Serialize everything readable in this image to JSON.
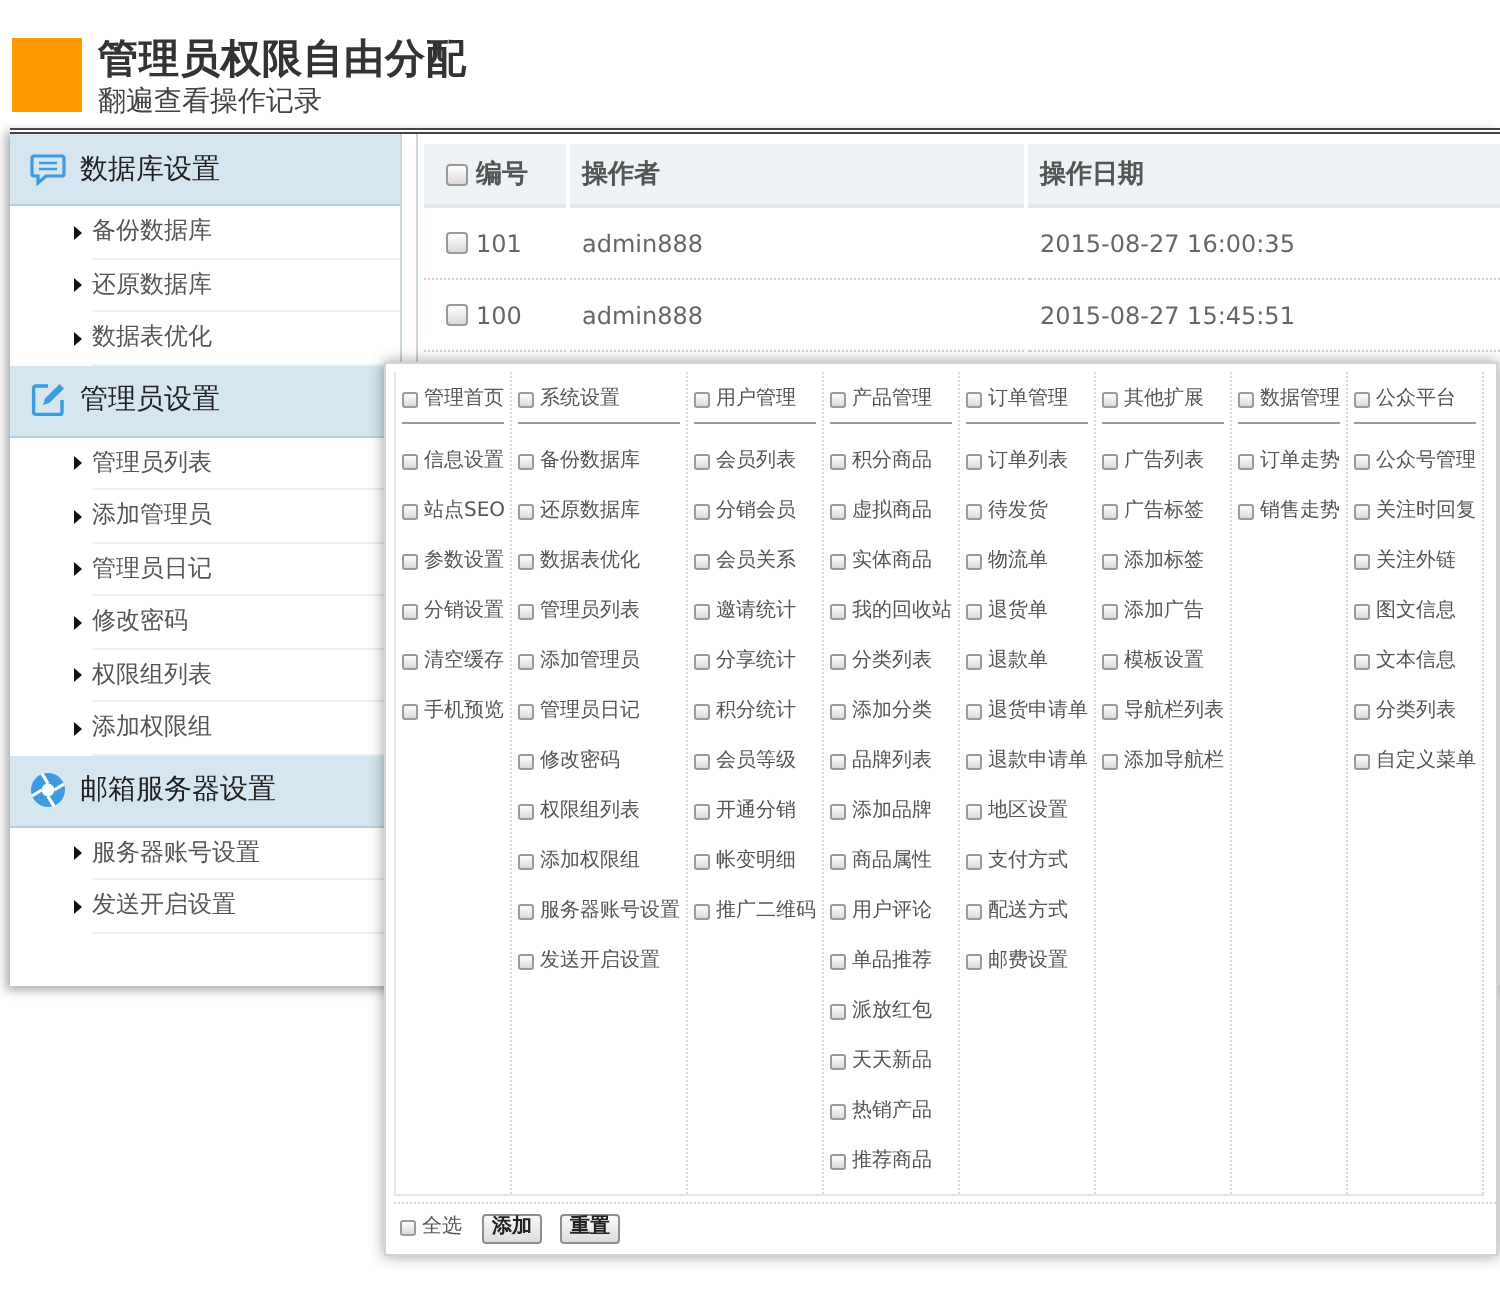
{
  "header": {
    "title": "管理员权限自由分配",
    "subtitle": "翻遍查看操作记录"
  },
  "sidebar": {
    "sections": [
      {
        "title": "数据库设置",
        "items": [
          "备份数据库",
          "还原数据库",
          "数据表优化"
        ]
      },
      {
        "title": "管理员设置",
        "items": [
          "管理员列表",
          "添加管理员",
          "管理员日记",
          "修改密码",
          "权限组列表",
          "添加权限组"
        ]
      },
      {
        "title": "邮箱服务器设置",
        "items": [
          "服务器账号设置",
          "发送开启设置"
        ]
      }
    ]
  },
  "log_table": {
    "select_all": {
      "checked": false
    },
    "columns": [
      "编号",
      "操作者",
      "操作日期"
    ],
    "rows": [
      {
        "checked": false,
        "cells": [
          "101",
          "admin888",
          "2015-08-27 16:00:35"
        ]
      },
      {
        "checked": false,
        "cells": [
          "100",
          "admin888",
          "2015-08-27 15:45:51"
        ]
      }
    ]
  },
  "permission_dialog": {
    "groups": [
      {
        "title": "管理首页",
        "checked": false,
        "items": [
          {
            "label": "信息设置",
            "checked": false
          },
          {
            "label": "站点SEO",
            "checked": false
          },
          {
            "label": "参数设置",
            "checked": false
          },
          {
            "label": "分销设置",
            "checked": false
          },
          {
            "label": "清空缓存",
            "checked": false
          },
          {
            "label": "手机预览",
            "checked": false
          }
        ]
      },
      {
        "title": "系统设置",
        "checked": false,
        "items": [
          {
            "label": "备份数据库",
            "checked": false
          },
          {
            "label": "还原数据库",
            "checked": false
          },
          {
            "label": "数据表优化",
            "checked": false
          },
          {
            "label": "管理员列表",
            "checked": false
          },
          {
            "label": "添加管理员",
            "checked": false
          },
          {
            "label": "管理员日记",
            "checked": false
          },
          {
            "label": "修改密码",
            "checked": false
          },
          {
            "label": "权限组列表",
            "checked": false
          },
          {
            "label": "添加权限组",
            "checked": false
          },
          {
            "label": "服务器账号设置",
            "checked": false
          },
          {
            "label": "发送开启设置",
            "checked": false
          }
        ]
      },
      {
        "title": "用户管理",
        "checked": false,
        "items": [
          {
            "label": "会员列表",
            "checked": false
          },
          {
            "label": "分销会员",
            "checked": false
          },
          {
            "label": "会员关系",
            "checked": false
          },
          {
            "label": "邀请统计",
            "checked": false
          },
          {
            "label": "分享统计",
            "checked": false
          },
          {
            "label": "积分统计",
            "checked": false
          },
          {
            "label": "会员等级",
            "checked": false
          },
          {
            "label": "开通分销",
            "checked": false
          },
          {
            "label": "帐变明细",
            "checked": false
          },
          {
            "label": "推广二维码",
            "checked": false
          }
        ]
      },
      {
        "title": "产品管理",
        "checked": false,
        "items": [
          {
            "label": "积分商品",
            "checked": false
          },
          {
            "label": "虚拟商品",
            "checked": false
          },
          {
            "label": "实体商品",
            "checked": false
          },
          {
            "label": "我的回收站",
            "checked": false
          },
          {
            "label": "分类列表",
            "checked": false
          },
          {
            "label": "添加分类",
            "checked": false
          },
          {
            "label": "品牌列表",
            "checked": false
          },
          {
            "label": "添加品牌",
            "checked": false
          },
          {
            "label": "商品属性",
            "checked": false
          },
          {
            "label": "用户评论",
            "checked": false
          },
          {
            "label": "单品推荐",
            "checked": false
          },
          {
            "label": "派放红包",
            "checked": false
          },
          {
            "label": "天天新品",
            "checked": false
          },
          {
            "label": "热销产品",
            "checked": false
          },
          {
            "label": "推荐商品",
            "checked": false
          }
        ]
      },
      {
        "title": "订单管理",
        "checked": false,
        "items": [
          {
            "label": "订单列表",
            "checked": false
          },
          {
            "label": "待发货",
            "checked": false
          },
          {
            "label": "物流单",
            "checked": false
          },
          {
            "label": "退货单",
            "checked": false
          },
          {
            "label": "退款单",
            "checked": false
          },
          {
            "label": "退货申请单",
            "checked": false
          },
          {
            "label": "退款申请单",
            "checked": false
          },
          {
            "label": "地区设置",
            "checked": false
          },
          {
            "label": "支付方式",
            "checked": false
          },
          {
            "label": "配送方式",
            "checked": false
          },
          {
            "label": "邮费设置",
            "checked": false
          }
        ]
      },
      {
        "title": "其他扩展",
        "checked": false,
        "items": [
          {
            "label": "广告列表",
            "checked": false
          },
          {
            "label": "广告标签",
            "checked": false
          },
          {
            "label": "添加标签",
            "checked": false
          },
          {
            "label": "添加广告",
            "checked": false
          },
          {
            "label": "模板设置",
            "checked": false
          },
          {
            "label": "导航栏列表",
            "checked": false
          },
          {
            "label": "添加导航栏",
            "checked": false
          }
        ]
      },
      {
        "title": "数据管理",
        "checked": false,
        "items": [
          {
            "label": "订单走势",
            "checked": false
          },
          {
            "label": "销售走势",
            "checked": false
          }
        ]
      },
      {
        "title": "公众平台",
        "checked": false,
        "items": [
          {
            "label": "公众号管理",
            "checked": false
          },
          {
            "label": "关注时回复",
            "checked": false
          },
          {
            "label": "关注外链",
            "checked": false
          },
          {
            "label": "图文信息",
            "checked": false
          },
          {
            "label": "文本信息",
            "checked": false
          },
          {
            "label": "分类列表",
            "checked": false
          },
          {
            "label": "自定义菜单",
            "checked": false
          }
        ]
      }
    ],
    "footer": {
      "select_all": {
        "label": "全选",
        "checked": false
      },
      "buttons": [
        "添加",
        "重置"
      ]
    }
  }
}
